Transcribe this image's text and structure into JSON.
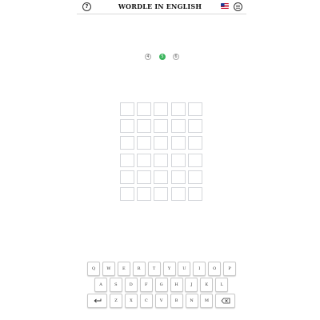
{
  "header": {
    "title": "WORDLE IN ENGLISH",
    "help_icon": "question-circle-icon",
    "help_glyph": "?",
    "flag_icon": "us-flag-icon",
    "menu_icon": "menu-circle-icon"
  },
  "word_length": {
    "options": [
      "4",
      "5",
      "6"
    ],
    "selected": "5",
    "active_color": "#3bb55d"
  },
  "board": {
    "rows": 6,
    "cols": 5,
    "guesses": [
      [
        "",
        "",
        "",
        "",
        ""
      ],
      [
        "",
        "",
        "",
        "",
        ""
      ],
      [
        "",
        "",
        "",
        "",
        ""
      ],
      [
        "",
        "",
        "",
        "",
        ""
      ],
      [
        "",
        "",
        "",
        "",
        ""
      ],
      [
        "",
        "",
        "",
        "",
        ""
      ]
    ],
    "tile_border_color": "#d3d6da"
  },
  "keyboard": {
    "row1": [
      "Q",
      "W",
      "E",
      "R",
      "T",
      "Y",
      "U",
      "I",
      "O",
      "P"
    ],
    "row2": [
      "A",
      "S",
      "D",
      "F",
      "G",
      "H",
      "J",
      "K",
      "L"
    ],
    "row3": [
      "Z",
      "X",
      "C",
      "V",
      "B",
      "N",
      "M"
    ],
    "enter_icon": "enter-return-icon",
    "backspace_icon": "backspace-icon"
  }
}
